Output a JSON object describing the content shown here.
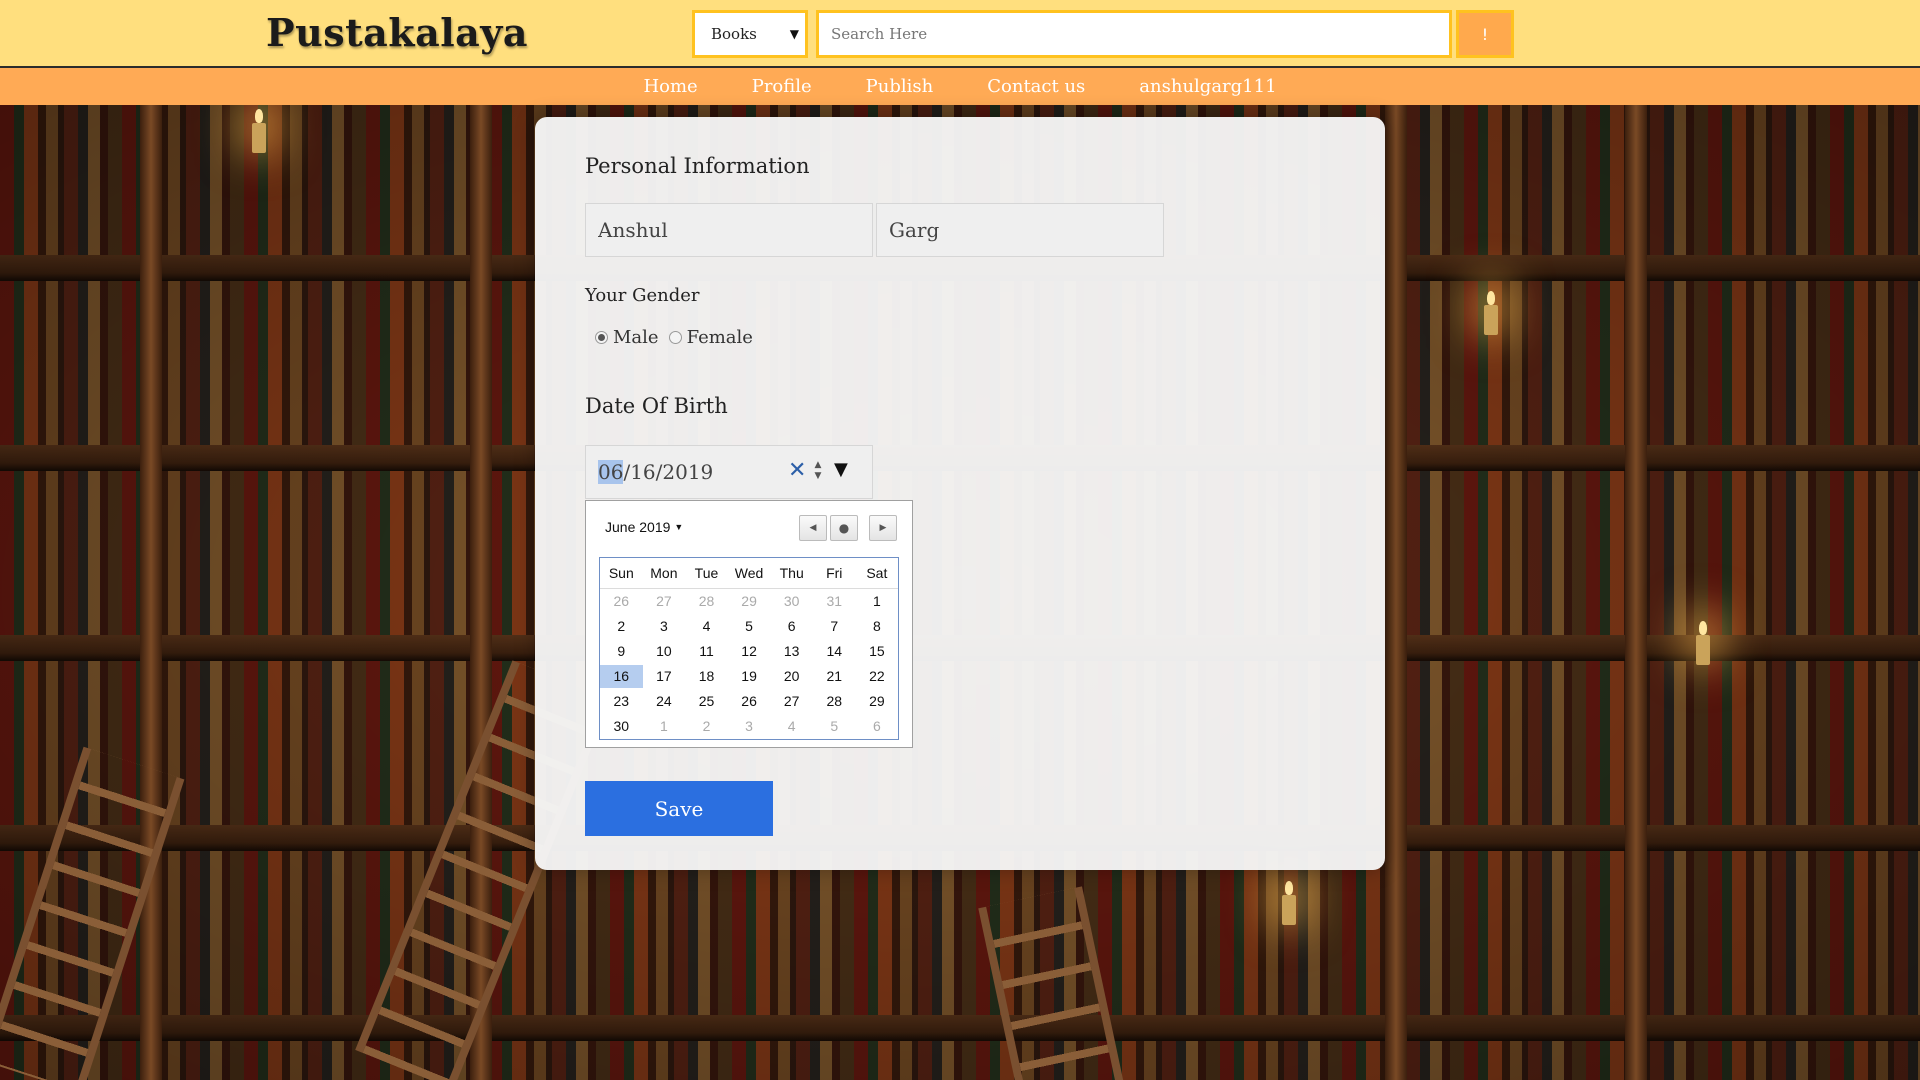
{
  "header": {
    "logo": "Pustakalaya",
    "category_select": {
      "selected": "Books"
    },
    "search": {
      "placeholder": "Search Here",
      "value": ""
    },
    "search_button_label": "!"
  },
  "nav": {
    "items": [
      {
        "label": "Home"
      },
      {
        "label": "Profile"
      },
      {
        "label": "Publish"
      },
      {
        "label": "Contact us"
      },
      {
        "label": "anshulgarg111"
      }
    ]
  },
  "form": {
    "personal_title": "Personal Information",
    "first_name": "Anshul",
    "last_name": "Garg",
    "gender_title": "Your Gender",
    "gender_options": [
      {
        "label": "Male",
        "checked": true
      },
      {
        "label": "Female",
        "checked": false
      }
    ],
    "dob_title": "Date Of Birth",
    "dob": {
      "month": "06",
      "rest": "/16/2019"
    },
    "save_label": "Save"
  },
  "calendar": {
    "month_label": "June 2019",
    "weekdays": [
      "Sun",
      "Mon",
      "Tue",
      "Wed",
      "Thu",
      "Fri",
      "Sat"
    ],
    "weeks": [
      [
        "26",
        "27",
        "28",
        "29",
        "30",
        "31",
        "1"
      ],
      [
        "2",
        "3",
        "4",
        "5",
        "6",
        "7",
        "8"
      ],
      [
        "9",
        "10",
        "11",
        "12",
        "13",
        "14",
        "15"
      ],
      [
        "16",
        "17",
        "18",
        "19",
        "20",
        "21",
        "22"
      ],
      [
        "23",
        "24",
        "25",
        "26",
        "27",
        "28",
        "29"
      ],
      [
        "30",
        "1",
        "2",
        "3",
        "4",
        "5",
        "6"
      ]
    ],
    "selected_day": "16"
  },
  "colors": {
    "header_bg": "#ffdf7e",
    "nav_bg": "#ffaa55",
    "accent_border": "#ffc21f",
    "save_button": "#2b6fe0"
  }
}
